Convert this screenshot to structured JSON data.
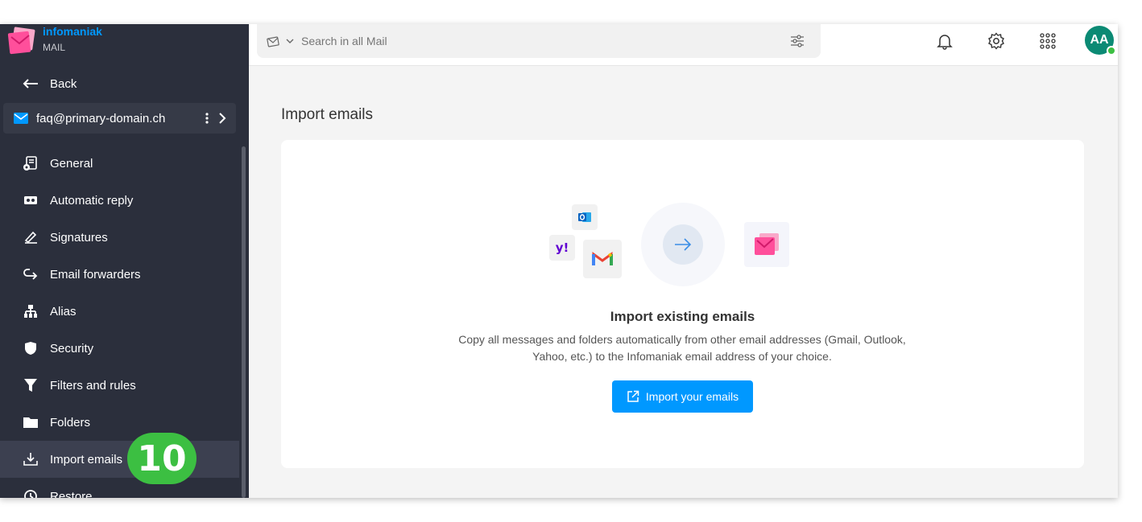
{
  "brand": {
    "name": "infomaniak",
    "product": "MAIL"
  },
  "sidebar": {
    "back_label": "Back",
    "account": "faq@primary-domain.ch",
    "items": [
      {
        "label": "General",
        "icon": "settings-doc-icon"
      },
      {
        "label": "Automatic reply",
        "icon": "auto-reply-icon"
      },
      {
        "label": "Signatures",
        "icon": "signature-icon"
      },
      {
        "label": "Email forwarders",
        "icon": "forward-icon"
      },
      {
        "label": "Alias",
        "icon": "alias-icon"
      },
      {
        "label": "Security",
        "icon": "shield-icon"
      },
      {
        "label": "Filters and rules",
        "icon": "filter-icon"
      },
      {
        "label": "Folders",
        "icon": "folder-icon"
      },
      {
        "label": "Import emails",
        "icon": "import-icon",
        "active": true
      },
      {
        "label": "Restore",
        "icon": "restore-icon"
      }
    ]
  },
  "step_badge": "10",
  "search": {
    "placeholder": "Search in all Mail"
  },
  "user": {
    "initials": "AA",
    "status": "online"
  },
  "main": {
    "title": "Import emails",
    "card": {
      "heading": "Import existing emails",
      "description": "Copy all messages and folders automatically from other email addresses (Gmail, Outlook, Yahoo, etc.) to the Infomaniak email address of your choice.",
      "button": "Import your emails"
    }
  },
  "colors": {
    "accent": "#0098ff",
    "sidebar_bg": "#2b2f3c",
    "badge": "#3cbf42",
    "avatar": "#0b8a74"
  }
}
